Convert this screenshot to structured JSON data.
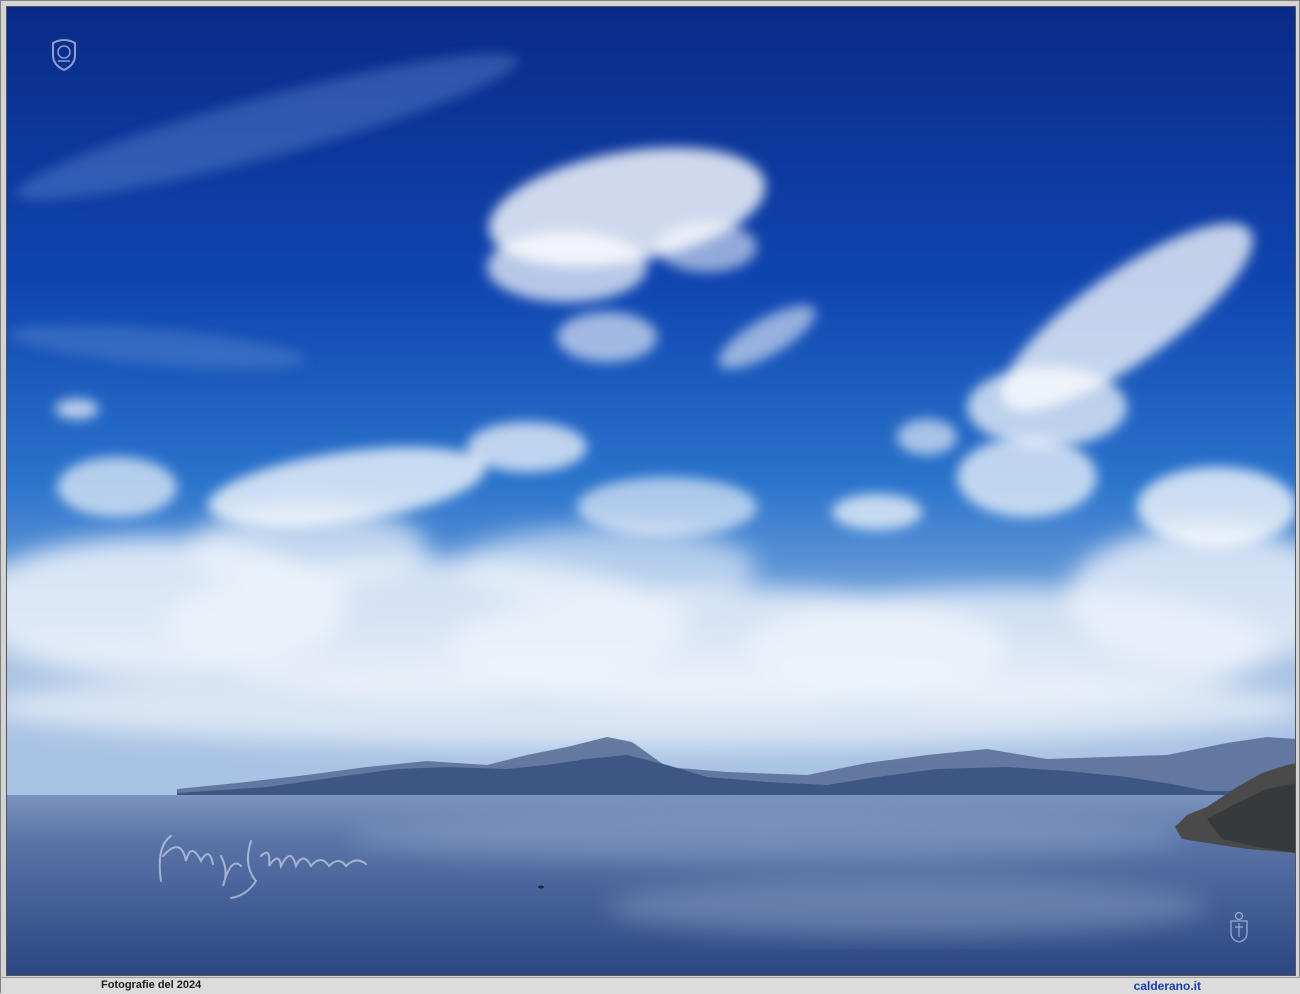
{
  "caption": {
    "left_text": "Fotografie del 2024",
    "right_text": "calderano.it"
  },
  "colors": {
    "sky_top": "#0b2e8f",
    "sky_mid": "#1a5fc4",
    "sky_horizon": "#8fb4dc",
    "sea_near": "#2f4c86",
    "sea_far": "#7d92bd",
    "mountains": "#3f5a85",
    "caption_link": "#1a3aa8"
  },
  "watermarks": {
    "top_left": "crest-icon",
    "bottom_right": "crest-icon",
    "signature": "signature-mark"
  }
}
